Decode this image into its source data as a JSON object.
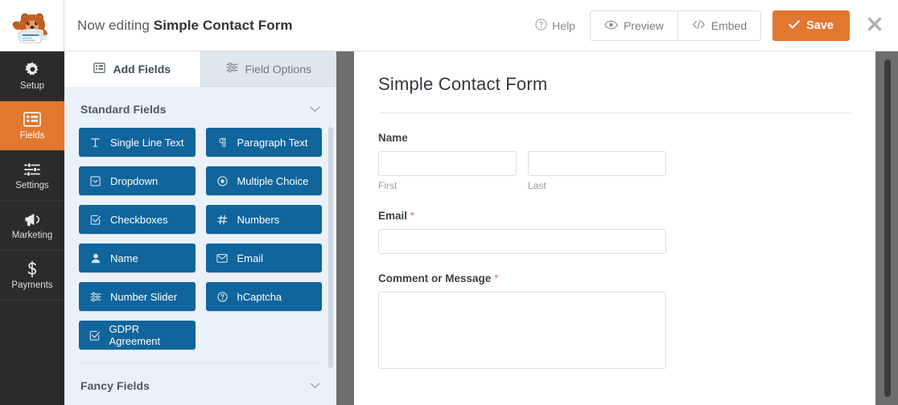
{
  "header": {
    "logo_icon": "wpforms-mascot-bear-icon",
    "editing_prefix": "Now editing",
    "form_name": "Simple Contact Form",
    "help_label": "Help",
    "help_icon": "question-circle-icon",
    "preview_label": "Preview",
    "preview_icon": "eye-icon",
    "embed_label": "Embed",
    "embed_icon": "code-brackets-icon",
    "save_label": "Save",
    "save_icon": "checkmark-icon",
    "close_icon": "close-x-icon",
    "save_color": "#e27730"
  },
  "sidebar": {
    "items": [
      {
        "label": "Setup",
        "icon": "gear-icon",
        "active": false
      },
      {
        "label": "Fields",
        "icon": "list-grid-icon",
        "active": true
      },
      {
        "label": "Settings",
        "icon": "sliders-icon",
        "active": false
      },
      {
        "label": "Marketing",
        "icon": "megaphone-icon",
        "active": false
      },
      {
        "label": "Payments",
        "icon": "dollar-sign-icon",
        "active": false
      }
    ],
    "active_color": "#e27730",
    "background": "#2b2b2b"
  },
  "fields_panel": {
    "tabs": [
      {
        "label": "Add Fields",
        "icon": "panel-list-icon",
        "active": true
      },
      {
        "label": "Field Options",
        "icon": "sliders-icon",
        "active": false
      }
    ],
    "standard_section": {
      "title": "Standard Fields",
      "chevron_icon": "chevron-down-icon",
      "fields": [
        {
          "label": "Single Line Text",
          "icon": "text-cursor-icon"
        },
        {
          "label": "Paragraph Text",
          "icon": "pilcrow-icon"
        },
        {
          "label": "Dropdown",
          "icon": "dropdown-box-icon"
        },
        {
          "label": "Multiple Choice",
          "icon": "radio-circle-icon"
        },
        {
          "label": "Checkboxes",
          "icon": "checkbox-icon"
        },
        {
          "label": "Numbers",
          "icon": "hash-icon"
        },
        {
          "label": "Name",
          "icon": "user-icon"
        },
        {
          "label": "Email",
          "icon": "envelope-icon"
        },
        {
          "label": "Number Slider",
          "icon": "sliders-icon"
        },
        {
          "label": "hCaptcha",
          "icon": "question-circle-icon"
        },
        {
          "label": "GDPR Agreement",
          "icon": "checkbox-icon"
        }
      ]
    },
    "fancy_section": {
      "title": "Fancy Fields",
      "chevron_icon": "chevron-down-icon"
    },
    "button_color": "#10659c",
    "background": "#eaf1f9"
  },
  "form_preview": {
    "title": "Simple Contact Form",
    "fields": [
      {
        "label": "Name",
        "required": false,
        "type": "name",
        "sub_labels": [
          "First",
          "Last"
        ]
      },
      {
        "label": "Email",
        "required": true,
        "required_mark": "*",
        "type": "text"
      },
      {
        "label": "Comment or Message",
        "required": true,
        "required_mark": "*",
        "type": "textarea"
      }
    ],
    "required_color": "#e27070"
  }
}
